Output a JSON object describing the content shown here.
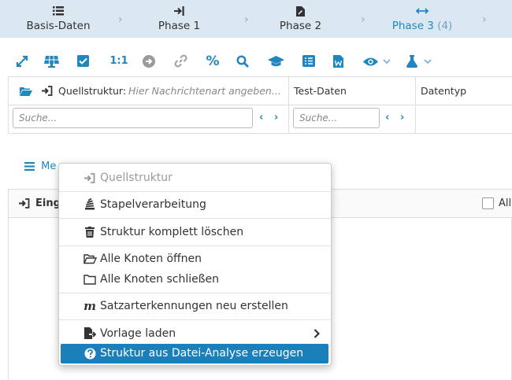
{
  "phases": [
    {
      "label": "Basis-Daten",
      "icon": "list-icon"
    },
    {
      "label": "Phase 1",
      "icon": "arrow-to-right-icon"
    },
    {
      "label": "Phase 2",
      "icon": "file-edit-icon"
    },
    {
      "label": "Phase 3",
      "count": "(4)",
      "icon": "arrows-h-icon"
    }
  ],
  "toolbar": {
    "ratio_label": "1:1",
    "percent_label": "%"
  },
  "grid": {
    "source_label": "Quellstruktur:",
    "source_placeholder": "Hier Nachrichtenart angeben...",
    "test_data_header": "Test-Daten",
    "datatype_header": "Datentyp",
    "search_placeholder_1": "Suche...",
    "search_placeholder_2": "Suche..."
  },
  "menu_button": {
    "label": "Me"
  },
  "panel": {
    "title": "Eing",
    "all_label": "All"
  },
  "context_menu": {
    "items": [
      {
        "label": "Quellstruktur",
        "icon": "sign-in-icon",
        "disabled": true
      },
      {
        "label": "Stapelverarbeitung",
        "icon": "stack-icon"
      },
      {
        "label": "Struktur komplett löschen",
        "icon": "trash-icon"
      },
      {
        "label": "Alle Knoten öffnen",
        "icon": "folder-open-icon"
      },
      {
        "label": "Alle Knoten schließen",
        "icon": "folder-icon"
      },
      {
        "label": "Satzarterkennungen neu erstellen",
        "icon": "m-icon"
      },
      {
        "label": "Vorlage laden",
        "icon": "file-import-icon",
        "submenu": true
      },
      {
        "label": "Struktur aus Datei-Analyse erzeugen",
        "icon": "question-circle-icon",
        "selected": true
      }
    ]
  },
  "colors": {
    "accent": "#1f86c0",
    "phasebar_bg": "#dbe7f1",
    "selection": "#1b7fba"
  }
}
